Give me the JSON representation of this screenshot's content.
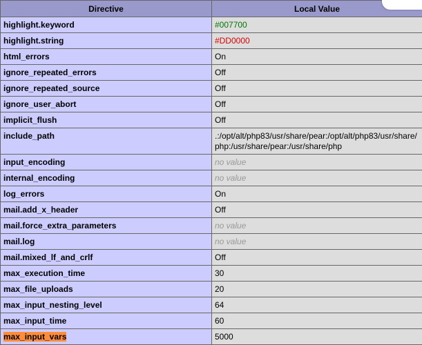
{
  "header": {
    "directive": "Directive",
    "local_value": "Local Value"
  },
  "rows": [
    {
      "directive": "highlight.keyword",
      "value": "#007700",
      "color": "#007700"
    },
    {
      "directive": "highlight.string",
      "value": "#DD0000",
      "color": "#DD0000"
    },
    {
      "directive": "html_errors",
      "value": "On"
    },
    {
      "directive": "ignore_repeated_errors",
      "value": "Off"
    },
    {
      "directive": "ignore_repeated_source",
      "value": "Off"
    },
    {
      "directive": "ignore_user_abort",
      "value": "Off"
    },
    {
      "directive": "implicit_flush",
      "value": "Off"
    },
    {
      "directive": "include_path",
      "value": ".:/opt/alt/php83/usr/share/pear:/opt/alt/php83/usr/share/php:/usr/share/pear:/usr/share/php"
    },
    {
      "directive": "input_encoding",
      "value": "no value",
      "no_value": true
    },
    {
      "directive": "internal_encoding",
      "value": "no value",
      "no_value": true
    },
    {
      "directive": "log_errors",
      "value": "On"
    },
    {
      "directive": "mail.add_x_header",
      "value": "Off"
    },
    {
      "directive": "mail.force_extra_parameters",
      "value": "no value",
      "no_value": true
    },
    {
      "directive": "mail.log",
      "value": "no value",
      "no_value": true
    },
    {
      "directive": "mail.mixed_lf_and_crlf",
      "value": "Off"
    },
    {
      "directive": "max_execution_time",
      "value": "30"
    },
    {
      "directive": "max_file_uploads",
      "value": "20"
    },
    {
      "directive": "max_input_nesting_level",
      "value": "64"
    },
    {
      "directive": "max_input_time",
      "value": "60"
    },
    {
      "directive": "max_input_vars",
      "value": "5000",
      "highlighted": true
    }
  ],
  "colors": {
    "header_bg": "#9999cc",
    "directive_bg": "#ccccff",
    "value_bg": "#dddddd",
    "no_value_text": "#999999",
    "search_highlight": "#ff8c3a"
  }
}
